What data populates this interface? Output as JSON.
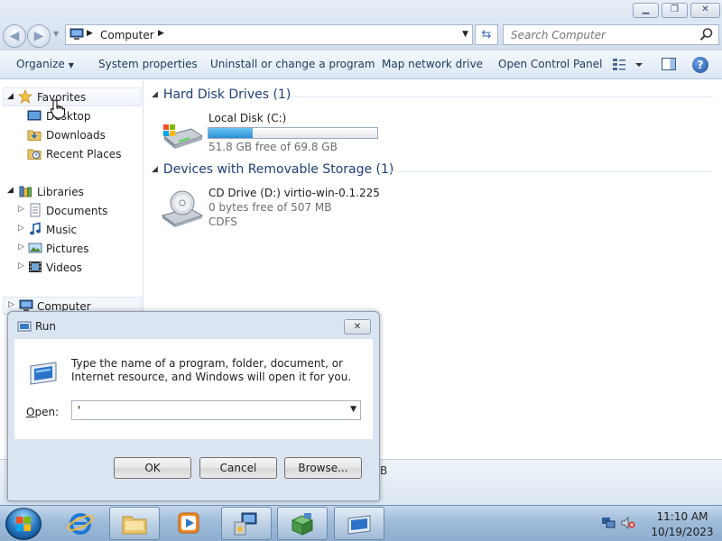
{
  "address": {
    "breadcrumb": "Computer",
    "search_placeholder": "Search Computer"
  },
  "toolbar": {
    "organize": "Organize",
    "system_properties": "System properties",
    "uninstall": "Uninstall or change a program",
    "map_drive": "Map network drive",
    "open_control_panel": "Open Control Panel"
  },
  "nav": {
    "favorites": "Favorites",
    "desktop": "Desktop",
    "downloads": "Downloads",
    "recent_places": "Recent Places",
    "libraries": "Libraries",
    "documents": "Documents",
    "music": "Music",
    "pictures": "Pictures",
    "videos": "Videos",
    "computer": "Computer"
  },
  "content": {
    "hdd_group": "Hard Disk Drives (1)",
    "local_disk": {
      "name": "Local Disk (C:)",
      "free_text": "51.8 GB free of 69.8 GB",
      "used_fraction": 0.26
    },
    "removable_group": "Devices with Removable Storage (1)",
    "cd_drive": {
      "name": "CD Drive (D:) virtio-win-0.1.225",
      "free_text": "0 bytes free of 507 MB",
      "fs": "CDFS"
    },
    "details_fragment": "B"
  },
  "run_dialog": {
    "title": "Run",
    "description": "Type the name of a program, folder, document, or Internet resource, and Windows will open it for you.",
    "open_label_prefix": "O",
    "open_label_rest": "pen:",
    "open_value": "'",
    "ok": "OK",
    "cancel": "Cancel",
    "browse": "Browse..."
  },
  "taskbar": {
    "time": "11:10 AM",
    "date": "10/19/2023"
  }
}
